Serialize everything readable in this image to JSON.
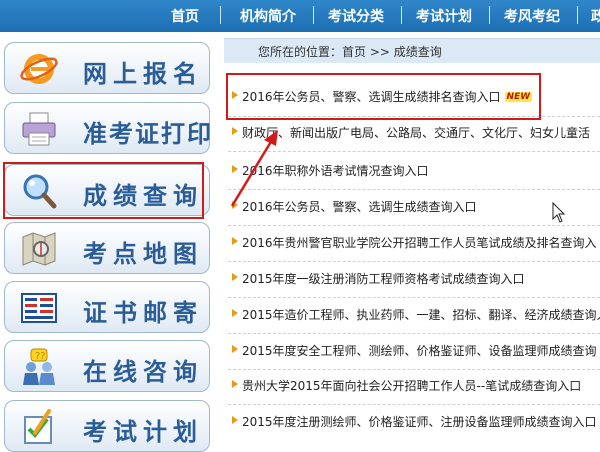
{
  "nav": {
    "items": [
      "首页",
      "机构简介",
      "考试分类",
      "考试计划",
      "考风考纪",
      "政"
    ]
  },
  "sidebar": {
    "items": [
      {
        "label": "网上报名",
        "icon": "ie-globe-icon"
      },
      {
        "label": "准考证打印",
        "icon": "printer-icon"
      },
      {
        "label": "成绩查询",
        "icon": "magnifier-icon"
      },
      {
        "label": "考点地图",
        "icon": "map-icon"
      },
      {
        "label": "证书邮寄",
        "icon": "certificate-icon"
      },
      {
        "label": "在线咨询",
        "icon": "consult-icon"
      },
      {
        "label": "考试计划",
        "icon": "plan-icon"
      }
    ]
  },
  "breadcrumb": {
    "text": "您所在的位置：首页 >> 成绩查询"
  },
  "list": {
    "new_badge": "NEW",
    "items": [
      "2016年公务员、警察、选调生成绩排名查询入口",
      "财政厅、新闻出版广电局、公路局、交通厅、文化厅、妇女儿童活",
      "2016年职称外语考试情况查询入口",
      "2016年公务员、警察、选调生成绩查询入口",
      "2016年贵州警官职业学院公开招聘工作人员笔试成绩及排名查询入",
      "2015年度一级注册消防工程师资格考试成绩查询入口",
      "2015年造价工程师、执业药师、一建、招标、翻译、经济成绩查询入",
      "2015年度安全工程师、测绘师、价格鉴证师、设备监理师成绩查询",
      "贵州大学2015年面向社会公开招聘工作人员--笔试成绩查询入口",
      "2015年度注册测绘师、价格鉴证师、注册设备监理师成绩查询入口"
    ]
  },
  "colors": {
    "nav_bg": "#1d6fb2",
    "highlight": "#d11a1a",
    "sidebar_text": "#2a5c98",
    "bullet": "#e79a12"
  }
}
